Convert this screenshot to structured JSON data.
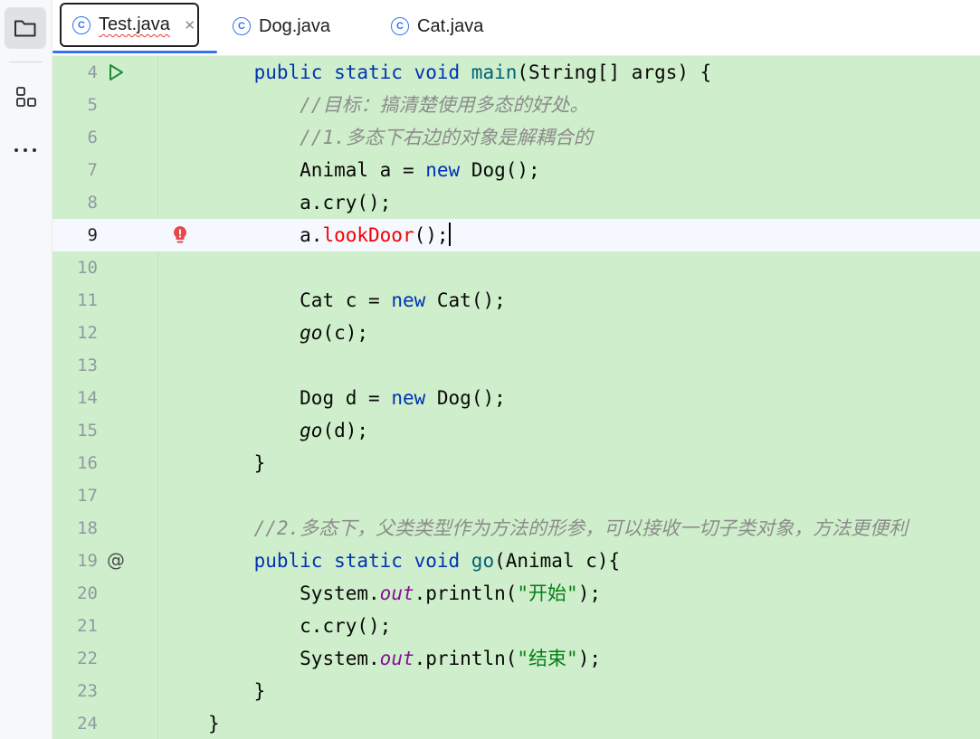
{
  "tabs": [
    {
      "label": "Test.java",
      "active": true
    },
    {
      "label": "Dog.java",
      "active": false
    },
    {
      "label": "Cat.java",
      "active": false
    }
  ],
  "icons": {
    "project": "folder-icon",
    "structure": "structure-icon",
    "more": "more-icon",
    "tab_class": "java-class-icon",
    "tab_close": "close-icon",
    "run": "run-icon",
    "override": "implemented-method-icon",
    "error": "error-bulb-icon"
  },
  "colors": {
    "editor_background": "#cfeecb",
    "current_line": "#f5f8fe",
    "accent": "#3574f0",
    "keyword": "#0033b3",
    "method": "#00627a",
    "comment": "#8c8c8c",
    "string": "#067d17",
    "error": "#f50000"
  },
  "editor": {
    "current_line": "9",
    "lines": [
      {
        "n": "4",
        "indent": "    ",
        "gutter": "run",
        "segs": [
          [
            "public static void ",
            "kw"
          ],
          [
            "main",
            "fn"
          ],
          [
            "(String[] args) {",
            ""
          ]
        ]
      },
      {
        "n": "5",
        "indent": "        ",
        "segs": [
          [
            "//目标：搞清楚使用多态的好处。",
            "cm"
          ]
        ]
      },
      {
        "n": "6",
        "indent": "        ",
        "segs": [
          [
            "//1.多态下右边的对象是解耦合的",
            "cm"
          ]
        ]
      },
      {
        "n": "7",
        "indent": "        ",
        "segs": [
          [
            "Animal a = ",
            ""
          ],
          [
            "new",
            "kw"
          ],
          [
            " Dog();",
            ""
          ]
        ]
      },
      {
        "n": "8",
        "indent": "        ",
        "segs": [
          [
            "a.cry();",
            ""
          ]
        ]
      },
      {
        "n": "9",
        "indent": "        ",
        "gutter": "error",
        "caret": true,
        "segs": [
          [
            "a.",
            ""
          ],
          [
            "lookDoor",
            "err"
          ],
          [
            "();",
            ""
          ]
        ]
      },
      {
        "n": "10",
        "indent": "",
        "segs": []
      },
      {
        "n": "11",
        "indent": "        ",
        "segs": [
          [
            "Cat c = ",
            ""
          ],
          [
            "new",
            "kw"
          ],
          [
            " Cat();",
            ""
          ]
        ]
      },
      {
        "n": "12",
        "indent": "        ",
        "segs": [
          [
            "go",
            "it"
          ],
          [
            "(c);",
            ""
          ]
        ]
      },
      {
        "n": "13",
        "indent": "",
        "segs": []
      },
      {
        "n": "14",
        "indent": "        ",
        "segs": [
          [
            "Dog d = ",
            ""
          ],
          [
            "new",
            "kw"
          ],
          [
            " Dog();",
            ""
          ]
        ]
      },
      {
        "n": "15",
        "indent": "        ",
        "segs": [
          [
            "go",
            "it"
          ],
          [
            "(d);",
            ""
          ]
        ]
      },
      {
        "n": "16",
        "indent": "    ",
        "segs": [
          [
            "}",
            ""
          ]
        ]
      },
      {
        "n": "17",
        "indent": "",
        "segs": []
      },
      {
        "n": "18",
        "indent": "    ",
        "segs": [
          [
            "//2.多态下，父类类型作为方法的形参，可以接收一切子类对象，方法更便利",
            "cm"
          ]
        ]
      },
      {
        "n": "19",
        "indent": "    ",
        "gutter": "override",
        "segs": [
          [
            "public static void ",
            "kw"
          ],
          [
            "go",
            "fn"
          ],
          [
            "(Animal c){",
            ""
          ]
        ]
      },
      {
        "n": "20",
        "indent": "        ",
        "segs": [
          [
            "System.",
            ""
          ],
          [
            "out",
            "fld"
          ],
          [
            ".println(",
            ""
          ],
          [
            "\"开始\"",
            "st"
          ],
          [
            ");",
            ""
          ]
        ]
      },
      {
        "n": "21",
        "indent": "        ",
        "segs": [
          [
            "c.cry();",
            ""
          ]
        ]
      },
      {
        "n": "22",
        "indent": "        ",
        "segs": [
          [
            "System.",
            ""
          ],
          [
            "out",
            "fld"
          ],
          [
            ".println(",
            ""
          ],
          [
            "\"结束\"",
            "st"
          ],
          [
            ");",
            ""
          ]
        ]
      },
      {
        "n": "23",
        "indent": "    ",
        "segs": [
          [
            "}",
            ""
          ]
        ]
      },
      {
        "n": "24",
        "indent": "",
        "segs": [
          [
            "}",
            ""
          ]
        ]
      }
    ]
  }
}
